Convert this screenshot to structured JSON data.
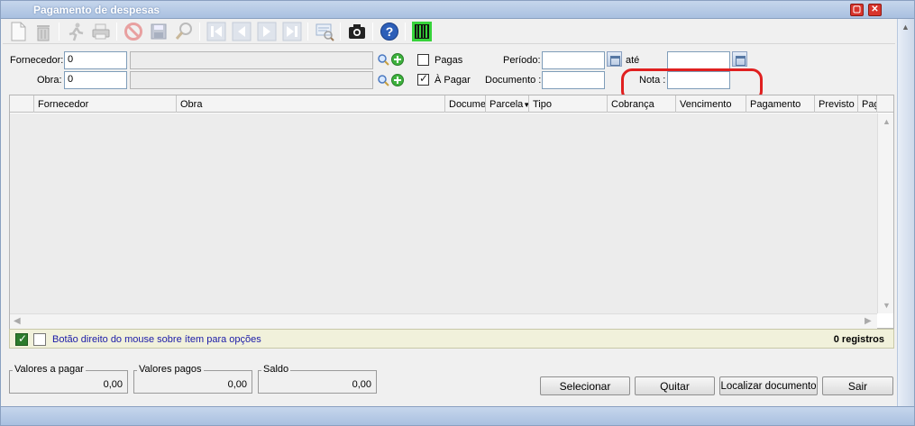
{
  "window": {
    "title": "Pagamento de despesas",
    "maximize_glyph": "▢",
    "close_glyph": "✕"
  },
  "toolbar": {
    "icons": [
      "new-document-icon",
      "trash-icon",
      "run-icon",
      "printer-icon",
      "cancel-icon",
      "save-icon",
      "search-icon",
      "first-record-icon",
      "previous-record-icon",
      "next-record-icon",
      "last-record-icon",
      "report-icon",
      "camera-icon",
      "help-icon",
      "barcode-icon"
    ]
  },
  "filters": {
    "fornecedor_label": "Fornecedor:",
    "fornecedor_code": "0",
    "fornecedor_name": "",
    "obra_label": "Obra:",
    "obra_code": "0",
    "obra_name": "",
    "pagas_label": "Pagas",
    "pagas_checked": false,
    "a_pagar_label": "À Pagar",
    "a_pagar_checked": true,
    "periodo_label": "Período:",
    "periodo_from": "",
    "ate_label": "até",
    "periodo_to": "",
    "documento_label": "Documento :",
    "documento_value": "",
    "nota_label": "Nota :",
    "nota_value": ""
  },
  "grid": {
    "columns": [
      "Fornecedor",
      "Obra",
      "Documen",
      "Parcela",
      "Tipo",
      "Cobrança",
      "Vencimento",
      "Pagamento",
      "Previsto P",
      "Pag"
    ],
    "rows": []
  },
  "status": {
    "hint": "Botão direito do mouse sobre ítem para opções",
    "count": "0 registros"
  },
  "totals": {
    "a_pagar_label": "Valores a pagar",
    "a_pagar_value": "0,00",
    "pagos_label": "Valores pagos",
    "pagos_value": "0,00",
    "saldo_label": "Saldo",
    "saldo_value": "0,00"
  },
  "buttons": {
    "selecionar": "Selecionar",
    "quitar": "Quitar",
    "localizar": "Localizar documento",
    "sair": "Sair"
  },
  "colors": {
    "highlight": "#e02020",
    "hint_text": "#1a1aa8",
    "status_bg": "#f1f1db",
    "title_bar": "#b7cbe6"
  }
}
